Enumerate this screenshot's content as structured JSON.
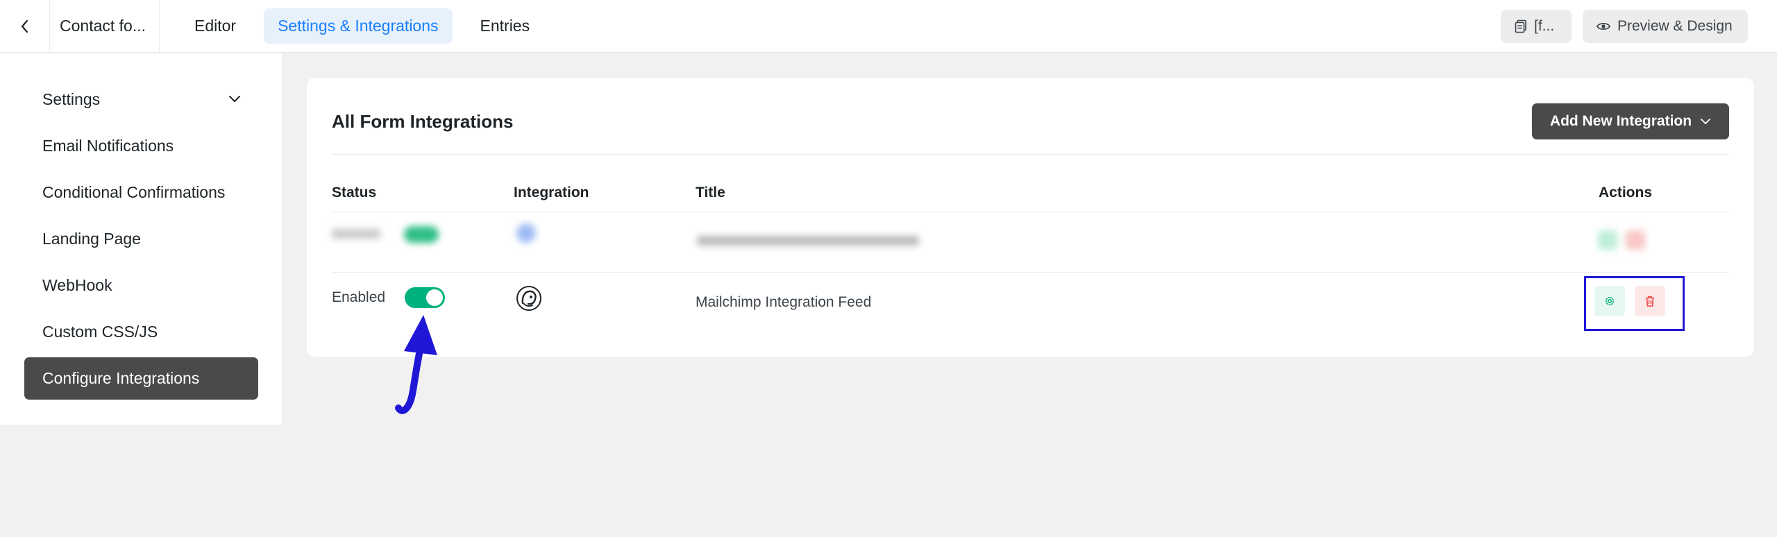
{
  "header": {
    "form_name": "Contact fo...",
    "tabs": [
      {
        "label": "Editor"
      },
      {
        "label": "Settings & Integrations"
      },
      {
        "label": "Entries"
      }
    ],
    "shortcode_label": "[f...",
    "preview_label": "Preview & Design"
  },
  "sidebar": {
    "items": [
      {
        "label": "Settings"
      },
      {
        "label": "Email Notifications"
      },
      {
        "label": "Conditional Confirmations"
      },
      {
        "label": "Landing Page"
      },
      {
        "label": "WebHook"
      },
      {
        "label": "Custom CSS/JS"
      },
      {
        "label": "Configure Integrations"
      }
    ]
  },
  "main": {
    "title": "All Form Integrations",
    "add_button_label": "Add New Integration",
    "columns": [
      "Status",
      "Integration",
      "Title",
      "Actions"
    ],
    "rows": [
      {
        "status": "Enabled",
        "title": "Mailchimp Integration Feed",
        "enabled": true
      }
    ]
  },
  "colors": {
    "accent": "#1a7efb",
    "toggle_on": "#00b27f",
    "highlight": "#1f16d6",
    "arrow": "#1f16d6",
    "dark_button": "#4a4a4a"
  }
}
